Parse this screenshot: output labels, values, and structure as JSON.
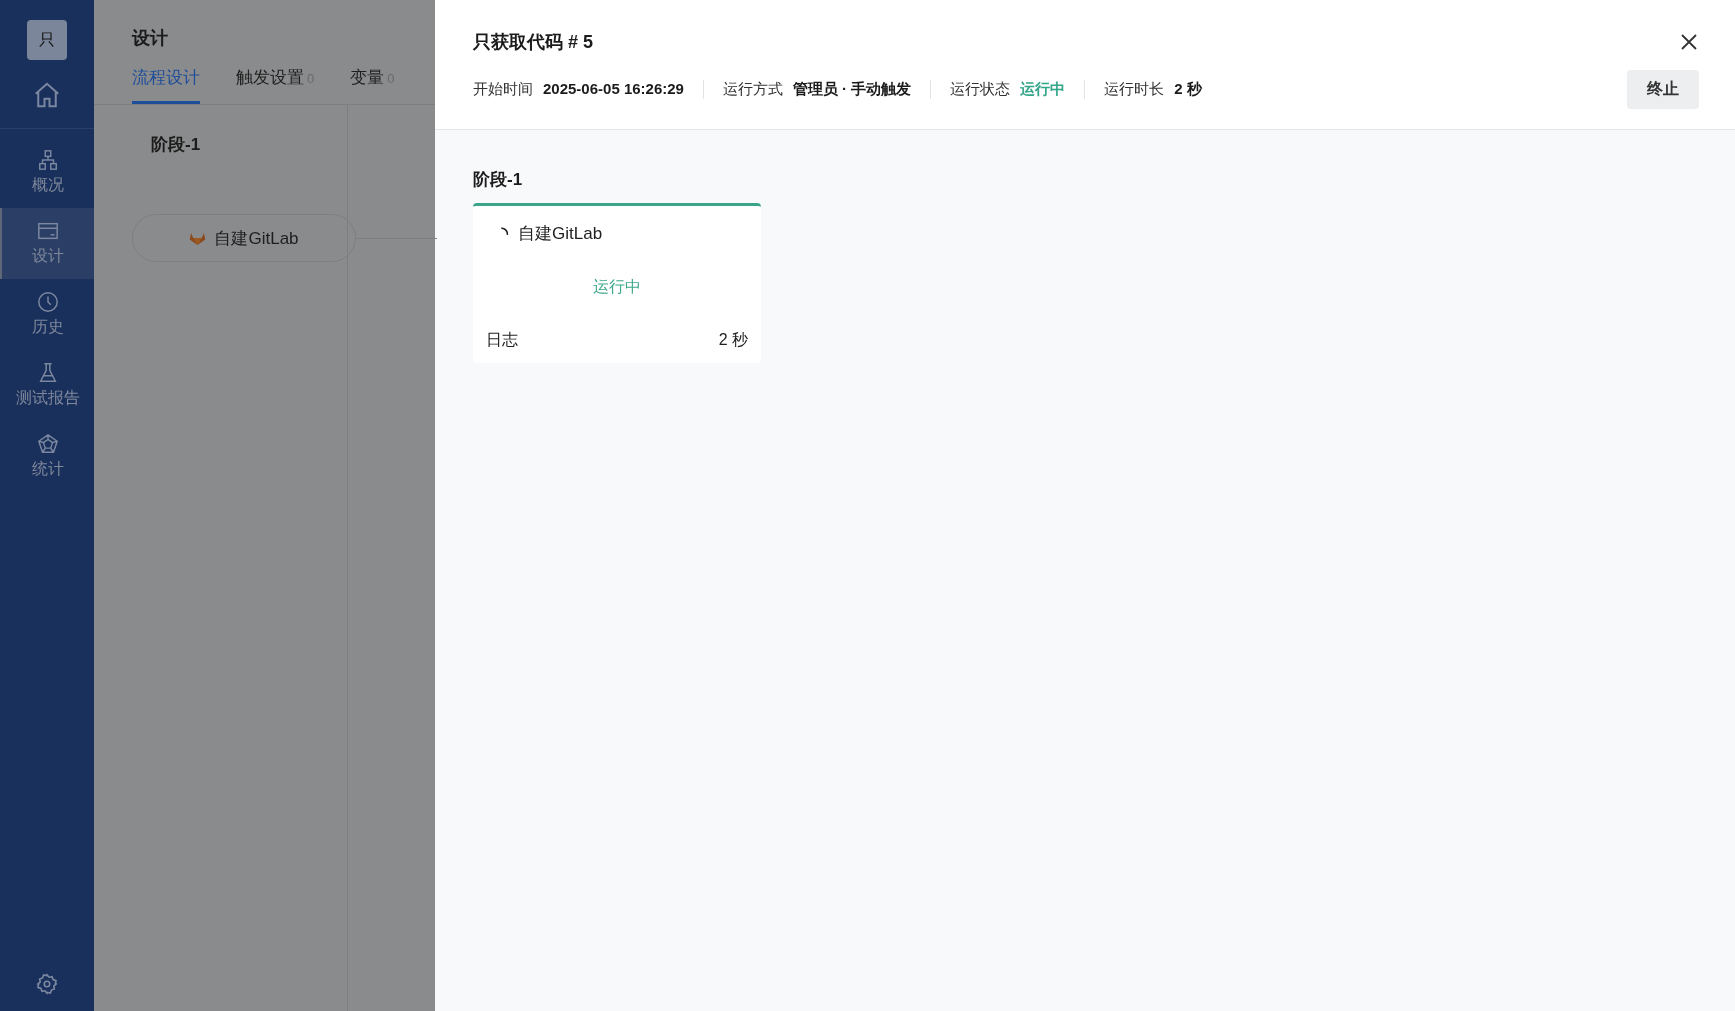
{
  "sidebar": {
    "logo": "只",
    "items": [
      {
        "label": "概况",
        "kind": "hierarchy",
        "selected": false
      },
      {
        "label": "设计",
        "kind": "card",
        "selected": true
      },
      {
        "label": "历史",
        "kind": "clock",
        "selected": false
      },
      {
        "label": "测试报告",
        "kind": "flask",
        "selected": false
      },
      {
        "label": "统计",
        "kind": "pentagon",
        "selected": false
      }
    ]
  },
  "background": {
    "title": "设计",
    "tabs": [
      {
        "label": "流程设计",
        "selected": true
      },
      {
        "label": "触发设置",
        "count": "0",
        "selected": false
      },
      {
        "label": "变量",
        "count": "0",
        "selected": false
      }
    ],
    "stage": {
      "name": "阶段-1",
      "job": "自建GitLab"
    }
  },
  "drawer": {
    "title": "只获取代码 # 5",
    "meta": [
      {
        "label": "开始时间",
        "value": "2025-06-05 16:26:29",
        "kind": "plain"
      },
      {
        "label": "运行方式",
        "value": "管理员 · 手动触发",
        "kind": "plain"
      },
      {
        "label": "运行状态",
        "value": "运行中",
        "kind": "status"
      },
      {
        "label": "运行时长",
        "value": "2 秒",
        "kind": "plain"
      }
    ],
    "stop_button": "终止",
    "stage": {
      "name": "阶段-1",
      "job": {
        "name": "自建GitLab",
        "status": "运行中",
        "log": "日志",
        "duration": "2 秒"
      }
    }
  }
}
